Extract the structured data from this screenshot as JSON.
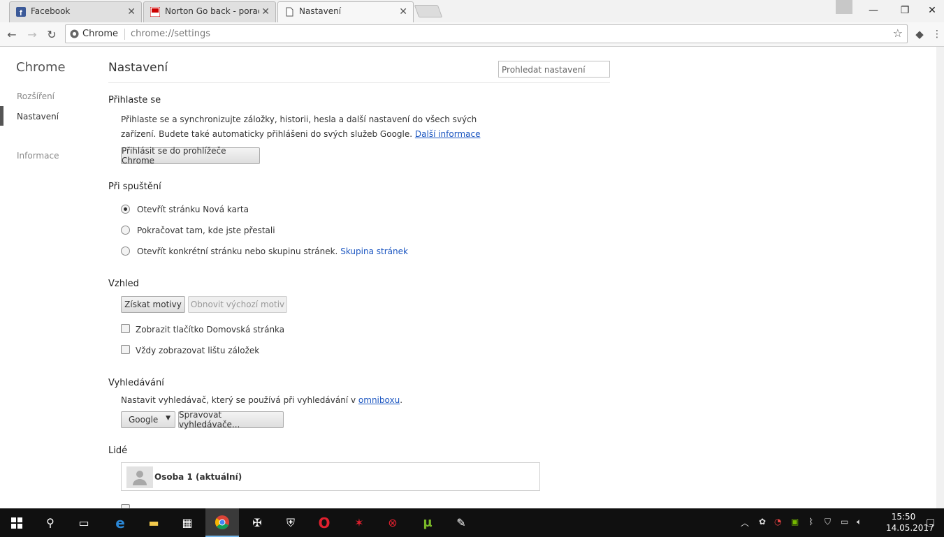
{
  "tabs": [
    {
      "title": "Facebook",
      "icon": "facebook-icon"
    },
    {
      "title": "Norton Go back - poradna",
      "icon": "norton-icon"
    },
    {
      "title": "Nastavení",
      "icon": "page-icon"
    }
  ],
  "omnibox": {
    "security_label": "Chrome",
    "url": "chrome://settings"
  },
  "sidebar": {
    "title": "Chrome",
    "items": [
      {
        "label": "Rozšíření"
      },
      {
        "label": "Nastavení"
      },
      {
        "label": "Informace"
      }
    ]
  },
  "main": {
    "title": "Nastavení",
    "search_placeholder": "Prohledat nastavení",
    "signin": {
      "heading": "Přihlaste se",
      "text": "Přihlaste se a synchronizujte záložky, historii, hesla a další nastavení do všech svých zařízení. Budete také automaticky přihlášeni do svých služeb Google.",
      "link": "Další informace",
      "button": "Přihlásit se do prohlížeče Chrome"
    },
    "startup": {
      "heading": "Při spuštění",
      "options": [
        {
          "label": "Otevřít stránku Nová karta",
          "checked": true
        },
        {
          "label": "Pokračovat tam, kde jste přestali",
          "checked": false
        },
        {
          "label": "Otevřít konkrétní stránku nebo skupinu stránek.",
          "checked": false
        }
      ],
      "pages_link": "Skupina stránek"
    },
    "appearance": {
      "heading": "Vzhled",
      "get_themes": "Získat motivy",
      "reset_theme": "Obnovit výchozí motiv",
      "show_home": "Zobrazit tlačítko Domovská stránka",
      "show_bookmarks": "Vždy zobrazovat lištu záložek"
    },
    "search": {
      "heading": "Vyhledávání",
      "text": "Nastavit vyhledávač, který se používá při vyhledávání v",
      "link": "omniboxu",
      "engine": "Google",
      "manage": "Spravovat vyhledávače..."
    },
    "people": {
      "heading": "Lidé",
      "person": "Osoba 1 (aktuální)"
    }
  },
  "taskbar": {
    "time": "15:50",
    "date": "14.05.2017"
  },
  "colors": {
    "link": "#1a55c0",
    "taskbar": "#101010",
    "accent": "#76b9ed"
  }
}
